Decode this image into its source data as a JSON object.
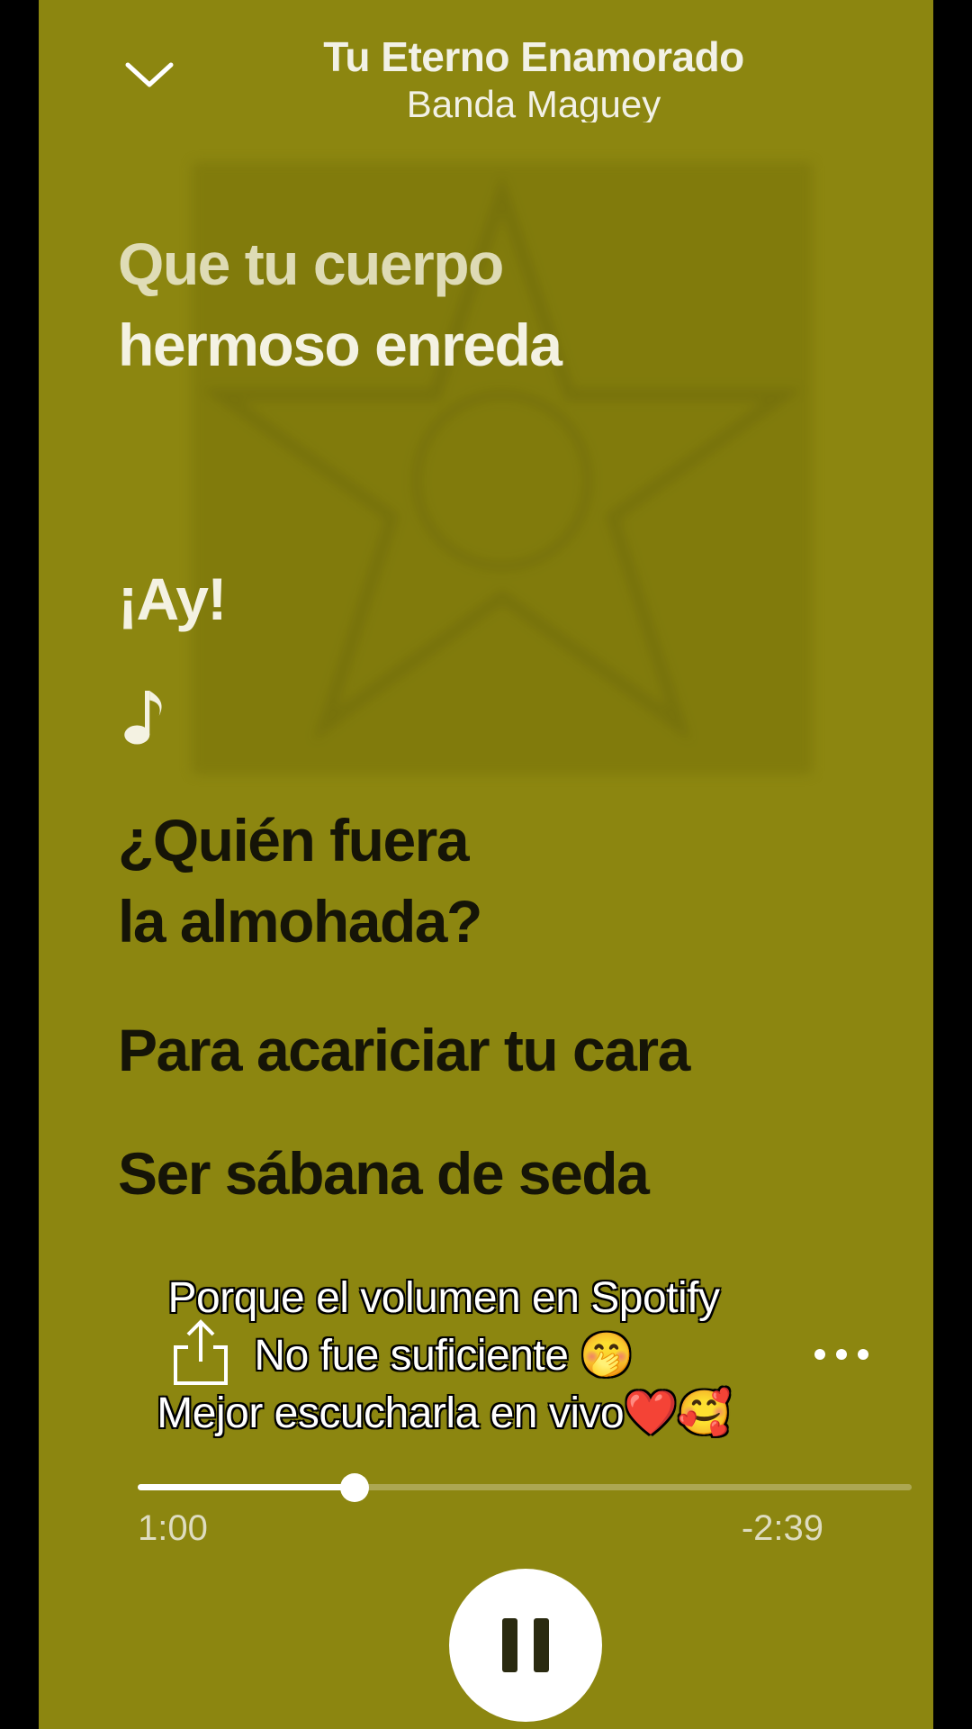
{
  "header": {
    "title": "Tu Eterno Enamorado",
    "artist": "Banda Maguey"
  },
  "lyrics": {
    "played": [
      "Que tu cuerpo",
      "hermoso enreda",
      "¡Ay!"
    ],
    "upcoming": [
      "¿Quién fuera",
      "la almohada?",
      "Para acariciar tu cara",
      "Ser sábana de seda"
    ]
  },
  "caption": {
    "line1": "Porque el volumen en Spotify",
    "line2": "No fue suficiente 🤭",
    "line3": "Mejor escucharla en vivo❤️🥰"
  },
  "playback": {
    "elapsed": "1:00",
    "remaining": "-2:39",
    "progress_fraction": 0.28,
    "state": "playing"
  },
  "icons": {
    "collapse": "chevron-down-icon",
    "share": "share-icon",
    "more": "more-options-icon",
    "note": "music-note-icon",
    "pause": "pause-icon"
  },
  "colors": {
    "background": "#8c8610",
    "lyric_played": "#f4f2e2",
    "lyric_upcoming": "#151407"
  }
}
